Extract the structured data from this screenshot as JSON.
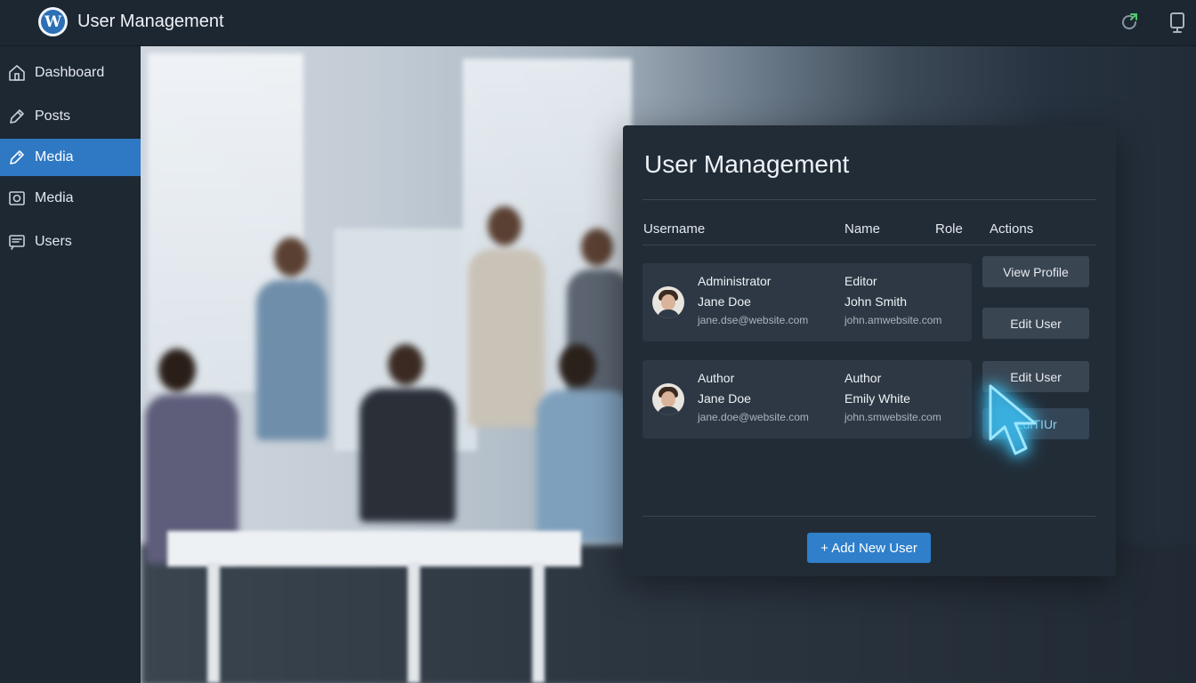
{
  "header": {
    "logo_icon": "wordpress-logo-icon",
    "logo_glyph": "W",
    "title": "User Management",
    "actions": [
      {
        "icon": "refresh-icon"
      },
      {
        "icon": "device-icon"
      }
    ]
  },
  "sidebar": {
    "items": [
      {
        "label": "Dashboard",
        "icon": "home-icon",
        "active": false
      },
      {
        "label": "Posts",
        "icon": "pencil-icon",
        "active": false
      },
      {
        "label": "Media",
        "icon": "tag-icon",
        "active": true
      },
      {
        "label": "Media",
        "icon": "camera-icon",
        "active": false
      },
      {
        "label": "Users",
        "icon": "users-icon",
        "active": false
      }
    ]
  },
  "panel": {
    "title": "User Management",
    "columns": [
      "Username",
      "Name",
      "Role",
      "Actions"
    ],
    "rows": [
      {
        "role_left": "Administrator",
        "name_left": "Jane Doe",
        "email_left": "jane.dse@website.com",
        "role_right": "Editor",
        "name_right": "John Smith",
        "email_right": "john.amwebsite.com",
        "actions": [
          "View Profile",
          "Edit User"
        ]
      },
      {
        "role_left": "Author",
        "name_left": "Jane Doe",
        "email_left": "jane.doe@website.com",
        "role_right": "Author",
        "name_right": "Emily White",
        "email_right": "john.smwebsite.com",
        "actions": [
          "Edit User",
          "EdiTIUr"
        ]
      }
    ],
    "add_button": "+ Add New User"
  },
  "colors": {
    "accent": "#2f78c4",
    "sidebar_bg": "#1e2833",
    "panel_bg": "#222c37",
    "cursor_glow": "#3cc3f5",
    "refresh_green": "#4cc96f"
  }
}
